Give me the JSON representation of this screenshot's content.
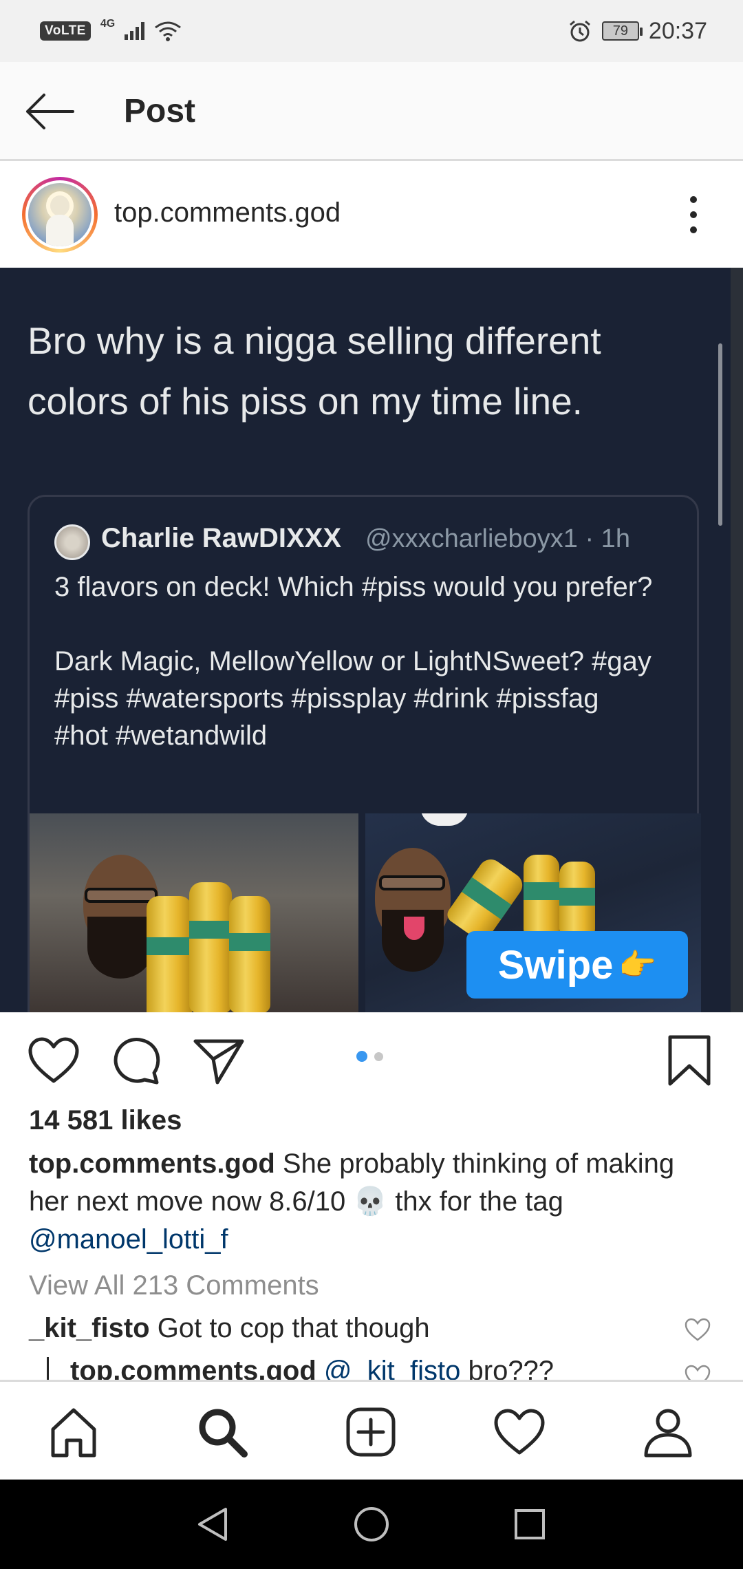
{
  "status_bar": {
    "volte": "VoLTE",
    "network": "4G",
    "battery": "79",
    "time": "20:37"
  },
  "header": {
    "title": "Post"
  },
  "post": {
    "username": "top.comments.god",
    "image": {
      "tweet_text": "Bro why is a nigga selling different colors of his piss on my time line.",
      "quote_name": "Charlie RawDIXXX",
      "quote_handle": "@xxxcharlieboyx1 · 1h",
      "quote_body": "3 flavors on deck! Which #piss would you prefer?\n\nDark Magic, MellowYellow or LightNSweet? #gay #piss #watersports #pissplay #drink #pissfag #hot #wetandwild",
      "swipe_label": "Swipe",
      "swipe_icon": "👉"
    },
    "carousel": {
      "count": 2,
      "active": 1,
      "active_color": "#3897f0",
      "inactive_color": "#c7c7c7"
    },
    "likes": "14 581 likes",
    "caption_user": "top.comments.god",
    "caption_text": "She probably thinking of making her next move now  8.6/10 💀 thx for the tag",
    "caption_mention": "@manoel_lotti_f",
    "view_all": "View All 213 Comments",
    "comments": [
      {
        "user": "_kit_fisto",
        "text": "Got to cop that though"
      },
      {
        "user": "top.comments.god",
        "mention": "@_kit_fisto",
        "text": "bro???"
      }
    ]
  },
  "bottom_nav": {
    "items": [
      "home-icon",
      "search-icon",
      "add-post-icon",
      "activity-heart-icon",
      "profile-icon"
    ]
  },
  "colors": {
    "link": "#00376b",
    "image_bg": "#1a2234",
    "swipe_badge": "#1d8ff2"
  }
}
